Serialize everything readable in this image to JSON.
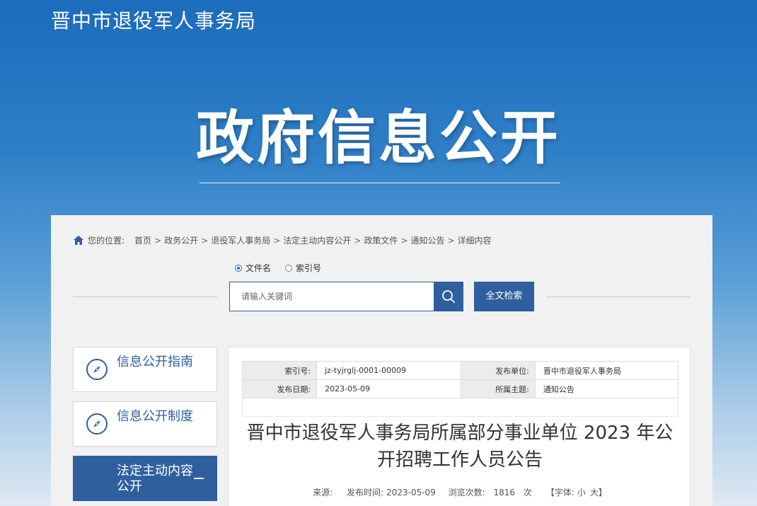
{
  "header": {
    "site_title": "晋中市退役军人事务局",
    "banner_title": "政府信息公开"
  },
  "breadcrumb": {
    "label": "您的位置:",
    "items": [
      "首页",
      "政务公开",
      "退役军人事务局",
      "法定主动内容公开",
      "政策文件",
      "通知公告",
      "详细内容"
    ],
    "separator": ">"
  },
  "search": {
    "radio_options": [
      {
        "label": "文件名",
        "checked": true
      },
      {
        "label": "索引号",
        "checked": false
      }
    ],
    "placeholder": "请输入关键词",
    "fulltext_label": "全文检索"
  },
  "sidebar": {
    "items": [
      {
        "label": "信息公开指南",
        "active": false
      },
      {
        "label": "信息公开制度",
        "active": false
      },
      {
        "label": "法定主动内容公开",
        "active": true
      }
    ]
  },
  "meta": {
    "index_label": "索引号:",
    "index_value": "jz-tyjrglj-0001-00009",
    "publisher_label": "发布单位:",
    "publisher_value": "晋中市退役军人事务局",
    "date_label": "发布日期:",
    "date_value": "2023-05-09",
    "topic_label": "所属主题:",
    "topic_value": "通知公告"
  },
  "article": {
    "title": "晋中市退役军人事务局所属部分事业单位 2023 年公开招聘工作人员公告",
    "source_label": "来源:",
    "time_label": "发布时间:",
    "time_value": "2023-05-09",
    "views_label": "浏览次数:",
    "views_value": "1816",
    "views_unit": "次",
    "font_label": "【字体:",
    "font_small": "小",
    "font_large": "大】"
  },
  "colors": {
    "primary": "#2f5f9e",
    "header_blue": "#1b6cbb"
  }
}
